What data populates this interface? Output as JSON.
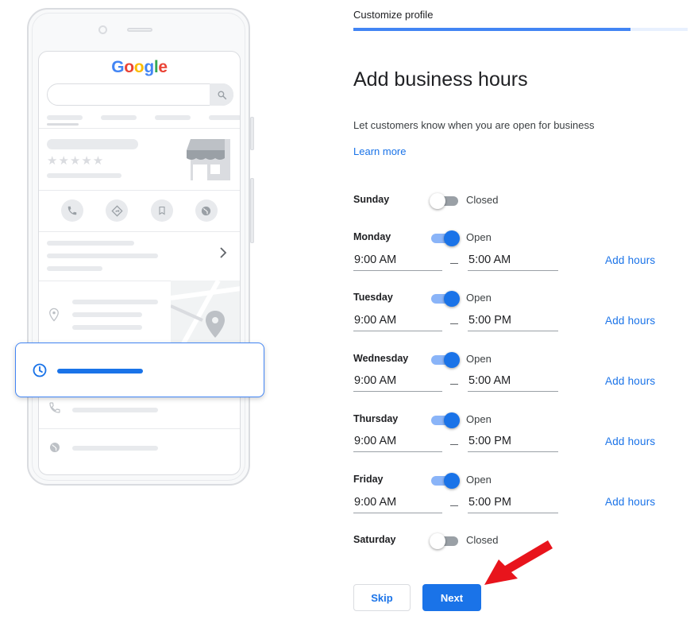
{
  "brand": {
    "logo_letters": [
      "G",
      "o",
      "o",
      "g",
      "l",
      "e"
    ],
    "logo_colors": [
      "#4285F4",
      "#EA4335",
      "#FBBC05",
      "#4285F4",
      "#34A853",
      "#EA4335"
    ]
  },
  "header": {
    "step_label": "Customize profile",
    "progress_fraction": 0.83
  },
  "main": {
    "title": "Add business hours",
    "subtitle": "Let customers know when you are open for business",
    "learn_more": "Learn more"
  },
  "days": [
    {
      "name": "Sunday",
      "open": false,
      "status": "Closed"
    },
    {
      "name": "Monday",
      "open": true,
      "status": "Open",
      "opens": "9:00 AM",
      "closes": "5:00 AM",
      "add_hours": "Add hours"
    },
    {
      "name": "Tuesday",
      "open": true,
      "status": "Open",
      "opens": "9:00 AM",
      "closes": "5:00 PM",
      "add_hours": "Add hours"
    },
    {
      "name": "Wednesday",
      "open": true,
      "status": "Open",
      "opens": "9:00 AM",
      "closes": "5:00 AM",
      "add_hours": "Add hours"
    },
    {
      "name": "Thursday",
      "open": true,
      "status": "Open",
      "opens": "9:00 AM",
      "closes": "5:00 PM",
      "add_hours": "Add hours"
    },
    {
      "name": "Friday",
      "open": true,
      "status": "Open",
      "opens": "9:00 AM",
      "closes": "5:00 PM",
      "add_hours": "Add hours"
    },
    {
      "name": "Saturday",
      "open": false,
      "status": "Closed"
    }
  ],
  "footer": {
    "skip_label": "Skip",
    "next_label": "Next"
  },
  "colors": {
    "accent": "#1a73e8",
    "annotation_arrow": "#e8141c"
  },
  "icons": [
    "search-icon",
    "star-icon",
    "storefront-icon",
    "phone-icon",
    "directions-icon",
    "bookmark-icon",
    "globe-icon",
    "chevron-right-icon",
    "location-pin-icon",
    "clock-icon",
    "red-arrow-annotation"
  ]
}
